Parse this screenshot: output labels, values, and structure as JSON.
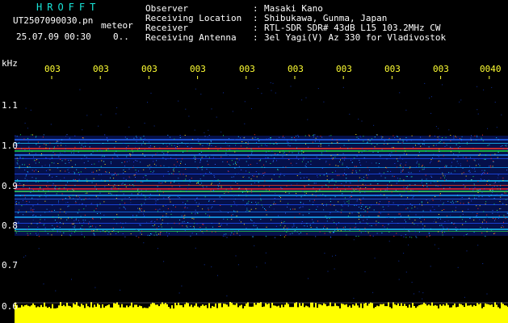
{
  "header": {
    "logo_text": "HROFFT",
    "filename": "UT2507090030.pn",
    "mode": "meteor",
    "datetime": "25.07.09 00:30",
    "rate": "0..",
    "meta": [
      {
        "label": "Observer",
        "value": "Masaki Kano"
      },
      {
        "label": "Receiving Location",
        "value": "Shibukawa, Gunma, Japan"
      },
      {
        "label": "Receiver",
        "value": "RTL-SDR SDR# 43dB L15 103.2MHz CW"
      },
      {
        "label": "Receiving Antenna",
        "value": "3el Yagi(V) Az 330 for Vladivostok"
      }
    ]
  },
  "axis": {
    "unit": "kHz",
    "y_ticks": [
      "1.1",
      "1.0",
      "0.9",
      "0.8",
      "0.7",
      "0.6"
    ],
    "x_ticks": [
      "003",
      "003",
      "003",
      "003",
      "003",
      "003",
      "003",
      "003",
      "003",
      "0040"
    ]
  },
  "colors": {
    "logo": "#19e6d9",
    "tick_label": "#ffff33",
    "background": "#000000",
    "signal_bar": "#ffff00"
  }
}
